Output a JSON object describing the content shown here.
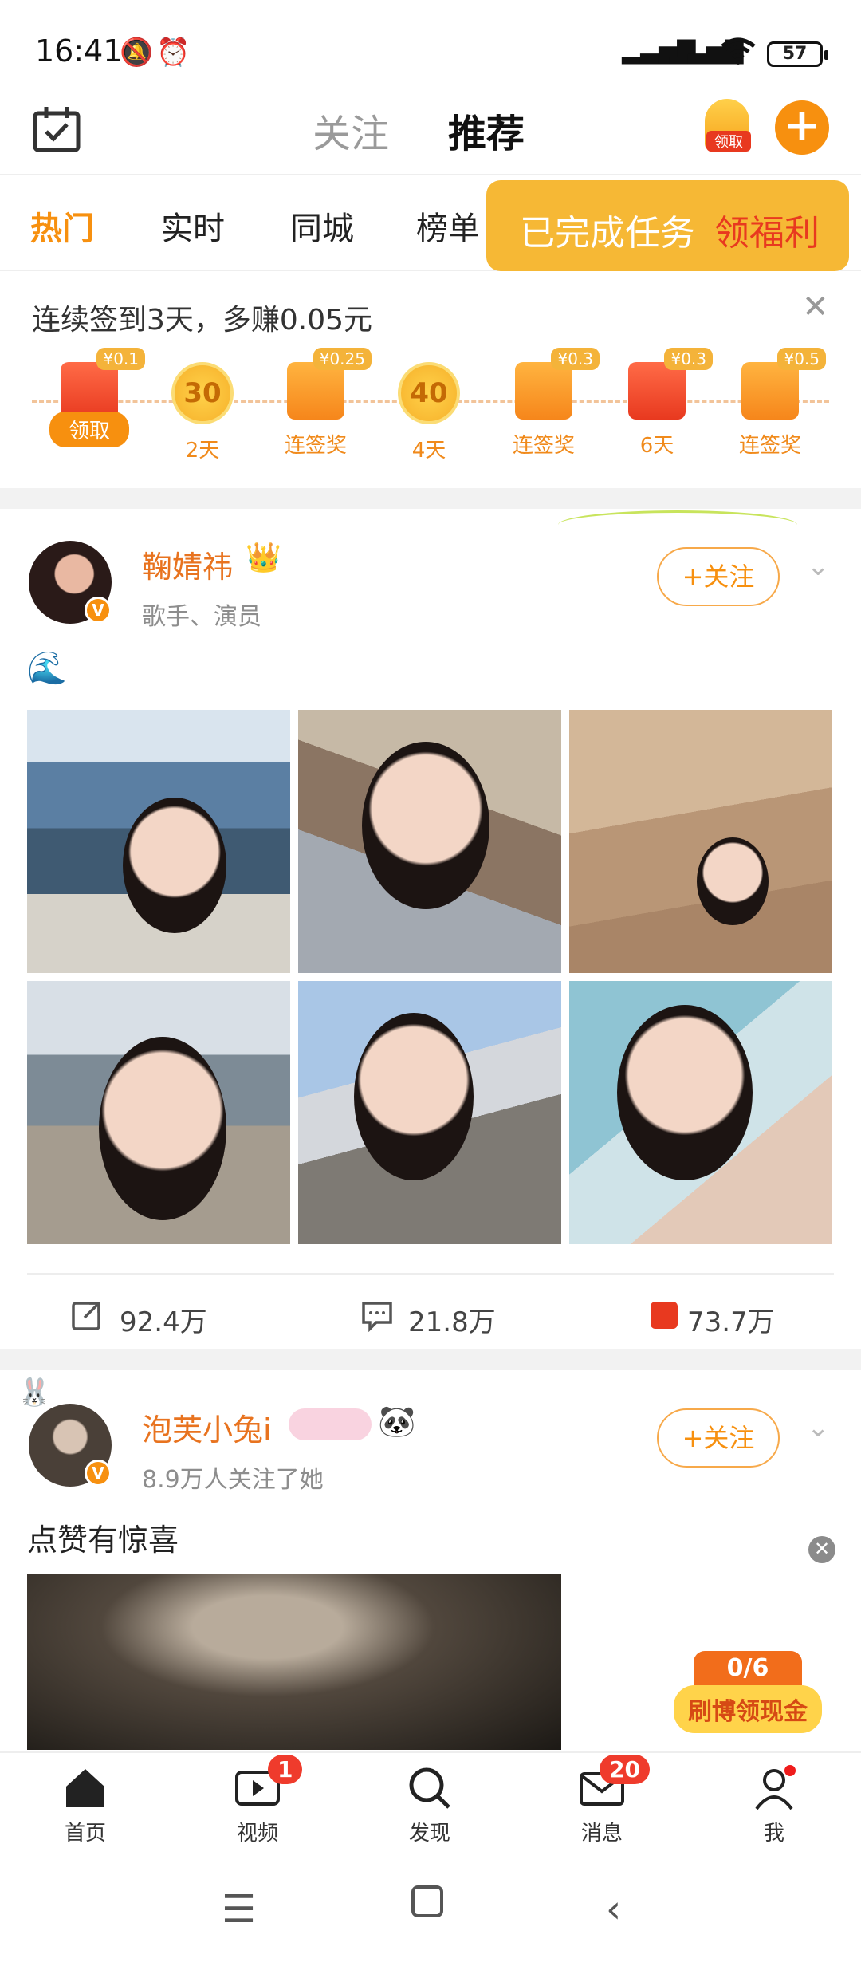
{
  "status": {
    "time": "16:41",
    "battery": "57"
  },
  "header": {
    "tabs": [
      "关注",
      "推荐"
    ],
    "claim_label": "领取",
    "plus": "+"
  },
  "categories": [
    "热门",
    "实时",
    "同城",
    "榜单"
  ],
  "task_popup": {
    "done": "已完成任务",
    "reward": "领福利"
  },
  "signin": {
    "title": "连续签到3天，多赚0.05元",
    "steps": [
      {
        "type": "redpack",
        "tag": "¥0.1",
        "label": "领取"
      },
      {
        "type": "coin",
        "value": "30",
        "label": "2天"
      },
      {
        "type": "redpack",
        "tag": "¥0.25",
        "label": "连签奖"
      },
      {
        "type": "coin",
        "value": "40",
        "label": "4天"
      },
      {
        "type": "redpack",
        "tag": "¥0.3",
        "label": "连签奖"
      },
      {
        "type": "redpack",
        "tag": "¥0.3",
        "label": "6天"
      },
      {
        "type": "redpack",
        "tag": "¥0.5",
        "label": "连签奖"
      }
    ]
  },
  "post1": {
    "user": "鞠婧祎",
    "subtitle": "歌手、演员",
    "follow": "+关注",
    "emoji": "🌊",
    "stats": {
      "repost": "92.4万",
      "comment": "21.8万",
      "like": "73.7万"
    }
  },
  "post2": {
    "user": "泡芙小兔i",
    "subtitle": "8.9万人关注了她",
    "follow": "+关注",
    "text": "点赞有惊喜"
  },
  "cash_widget": {
    "progress": "0/6",
    "label": "刷博领现金"
  },
  "bottom_nav": [
    {
      "label": "首页",
      "icon": "home-icon"
    },
    {
      "label": "视频",
      "icon": "video-icon",
      "badge": "1"
    },
    {
      "label": "发现",
      "icon": "search-icon"
    },
    {
      "label": "消息",
      "icon": "mail-icon",
      "badge": "20"
    },
    {
      "label": "我",
      "icon": "profile-icon"
    }
  ],
  "colors": {
    "accent": "#f7900f",
    "name": "#e8731f",
    "red": "#e8391f"
  }
}
